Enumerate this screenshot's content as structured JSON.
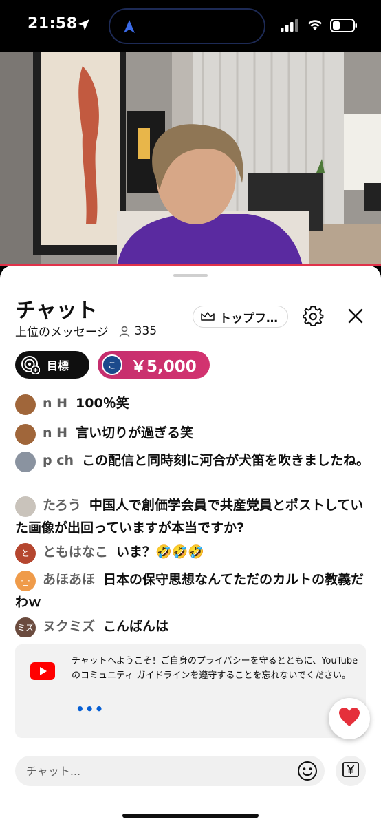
{
  "status_bar": {
    "time": "21:58"
  },
  "chat": {
    "title": "チャット",
    "subtitle": "上位のメッセージ",
    "viewer_count": "335",
    "top_fan_label": "トップフ…",
    "goal_label": "目標",
    "superchat": {
      "avatar": "こ",
      "amount": "￥5,000"
    },
    "messages": [
      {
        "author": "n H",
        "text": "100％笑",
        "avatar_color": "#a0663a",
        "avatar_text": ""
      },
      {
        "author": "n H",
        "text": "言い切りが過ぎる笑",
        "avatar_color": "#a0663a",
        "avatar_text": ""
      },
      {
        "author": "p ch",
        "text": "この配信と同時刻に河合が犬笛を吹きましたね。",
        "avatar_color": "#8a93a0",
        "avatar_text": ""
      },
      {
        "author": "たろう",
        "text": "中国人で創価学会員で共産党員とポストしていた画像が出回っていますが本当ですか?",
        "avatar_color": "#c9c3bb",
        "avatar_text": ""
      },
      {
        "author": "ともはなこ",
        "text": "いま？🤣🤣🤣",
        "avatar_color": "#b5462f",
        "avatar_text": "と"
      },
      {
        "author": "あほあほ",
        "text": "日本の保守思想なんてただのカルトの教義だわｗ",
        "avatar_color": "#ef9b4a",
        "avatar_text": "·_·"
      },
      {
        "author": "ヌクミズ",
        "text": "こんばんは",
        "avatar_color": "#6b4b3e",
        "avatar_text": "ミズ"
      }
    ],
    "welcome_text": "チャットへようこそ！ご自身のプライバシーを守るとともに、YouTube のコミュニティ ガイドラインを遵守することを忘れないでください。",
    "more_label": "•••",
    "input_placeholder": "チャット...",
    "heart_emoji": "❤️"
  },
  "colors": {
    "accent": "#d2336f",
    "progress": "#e0324a",
    "link": "#065fd4"
  }
}
